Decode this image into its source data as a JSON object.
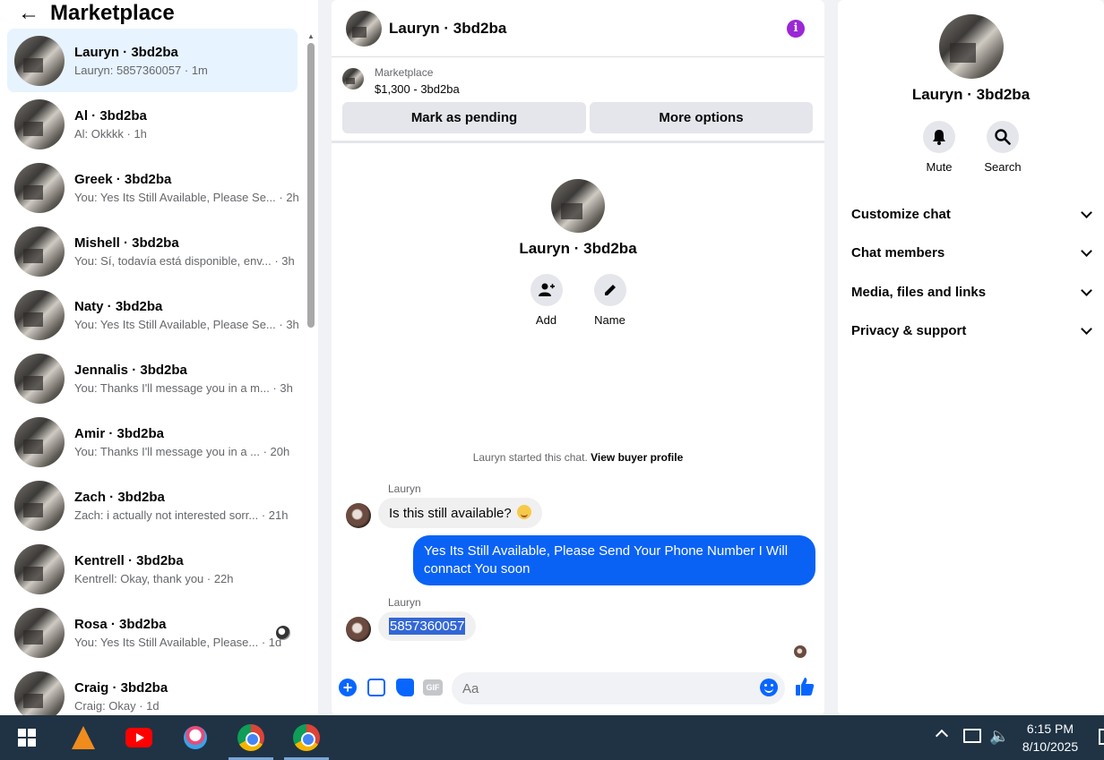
{
  "left_panel": {
    "title": "Marketplace",
    "conversations": [
      {
        "name": "Lauryn · 3bd2ba",
        "preview": "Lauryn: 5857360057 · 1m"
      },
      {
        "name": "Al · 3bd2ba",
        "preview": "Al: Okkkk · 1h"
      },
      {
        "name": "Greek · 3bd2ba",
        "preview": "You: Yes Its Still Available, Please Se... · 2h"
      },
      {
        "name": "Mishell · 3bd2ba",
        "preview": "You: Sí, todavía está disponible, env... · 3h"
      },
      {
        "name": "Naty · 3bd2ba",
        "preview": "You: Yes Its Still Available, Please Se... · 3h"
      },
      {
        "name": "Jennalis · 3bd2ba",
        "preview": "You: Thanks I'll message you in a m... · 3h"
      },
      {
        "name": "Amir · 3bd2ba",
        "preview": "You: Thanks I'll message you in a ... · 20h"
      },
      {
        "name": "Zach · 3bd2ba",
        "preview": "Zach: i actually not interested sorr... · 21h"
      },
      {
        "name": "Kentrell · 3bd2ba",
        "preview": "Kentrell: Okay, thank you · 22h"
      },
      {
        "name": "Rosa · 3bd2ba",
        "preview": "You: Yes Its Still Available, Please... · 1d"
      },
      {
        "name": "Craig · 3bd2ba",
        "preview": "Craig: Okay · 1d"
      }
    ]
  },
  "chat": {
    "header_name": "Lauryn · 3bd2ba",
    "listing_label": "Marketplace",
    "listing_price": "$1,300 - 3bd2ba",
    "mark_pending": "Mark as pending",
    "more_options": "More options",
    "profile_name": "Lauryn · 3bd2ba",
    "add_label": "Add",
    "name_label": "Name",
    "started_text": "Lauryn started this chat.",
    "view_buyer": "View buyer profile",
    "sender1": "Lauryn",
    "msg1": "Is this still available?",
    "msg2": "Yes Its Still Available, Please Send Your Phone Number I Will connact You soon",
    "sender2": "Lauryn",
    "msg3": "5857360057",
    "input_placeholder": "Aa"
  },
  "right_panel": {
    "name": "Lauryn · 3bd2ba",
    "mute": "Mute",
    "search": "Search",
    "sections": [
      "Customize chat",
      "Chat members",
      "Media, files and links",
      "Privacy & support"
    ]
  },
  "taskbar": {
    "time": "6:15 PM",
    "date": "8/10/2025"
  },
  "colors": {
    "accent": "#0866ff",
    "outgoing_bubble": "#0a62f5",
    "info": "#9b27d6",
    "taskbar": "#1f3345"
  }
}
